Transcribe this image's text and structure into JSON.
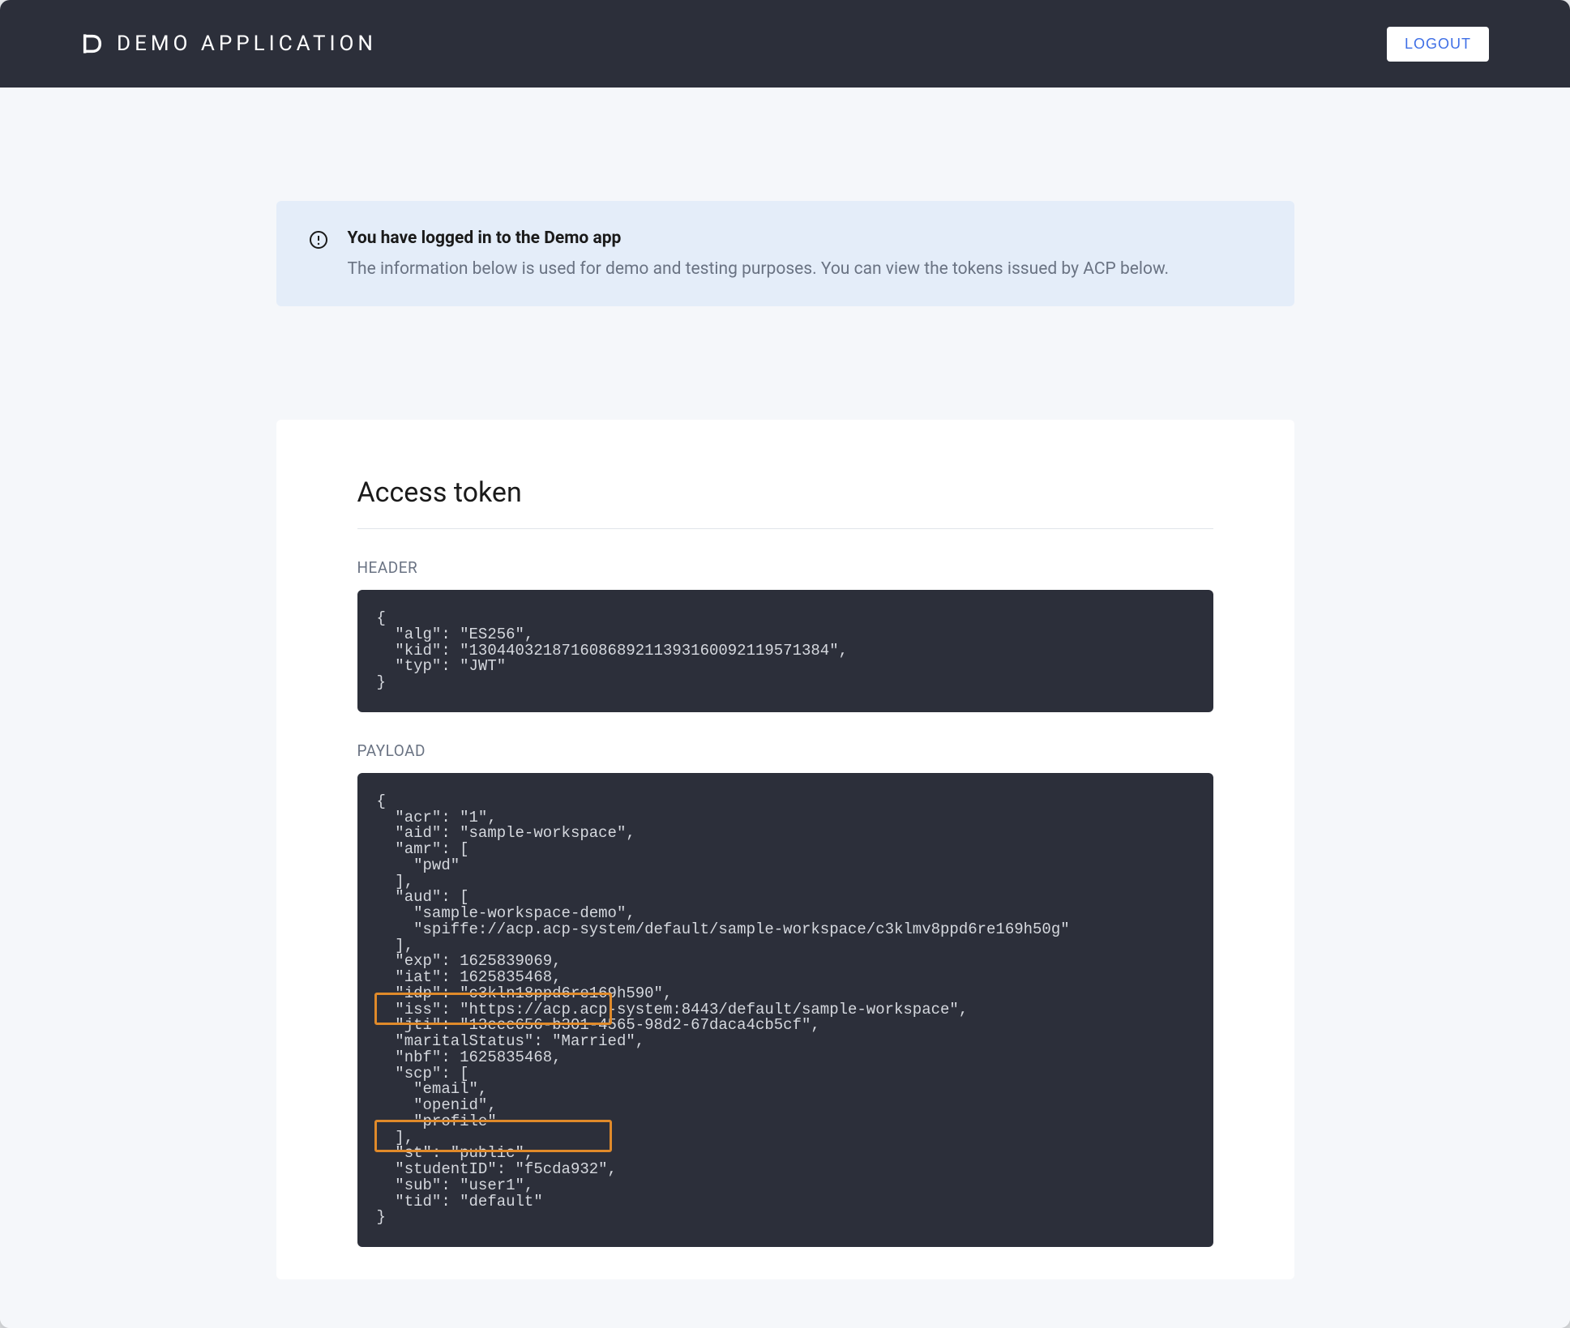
{
  "header": {
    "brand_title": "DEMO APPLICATION",
    "logout_label": "LOGOUT"
  },
  "info_banner": {
    "title": "You have logged in to the Demo app",
    "description": "The information below is used for demo and testing purposes. You can view the tokens issued by ACP below."
  },
  "token_section": {
    "heading": "Access token",
    "header_label": "HEADER",
    "header_code": "{\n  \"alg\": \"ES256\",\n  \"kid\": \"130440321871608689211393160092119571384\",\n  \"typ\": \"JWT\"\n}",
    "payload_label": "PAYLOAD",
    "payload_code": "{\n  \"acr\": \"1\",\n  \"aid\": \"sample-workspace\",\n  \"amr\": [\n    \"pwd\"\n  ],\n  \"aud\": [\n    \"sample-workspace-demo\",\n    \"spiffe://acp.acp-system/default/sample-workspace/c3klmv8ppd6re169h50g\"\n  ],\n  \"exp\": 1625839069,\n  \"iat\": 1625835468,\n  \"idp\": \"c3kln18ppd6re169h590\",\n  \"iss\": \"https://acp.acp-system:8443/default/sample-workspace\",\n  \"jti\": \"13eee656-b301-4565-98d2-67daca4cb5cf\",\n  \"maritalStatus\": \"Married\",\n  \"nbf\": 1625835468,\n  \"scp\": [\n    \"email\",\n    \"openid\",\n    \"profile\"\n  ],\n  \"st\": \"public\",\n  \"studentID\": \"f5cda932\",\n  \"sub\": \"user1\",\n  \"tid\": \"default\"\n}"
  }
}
